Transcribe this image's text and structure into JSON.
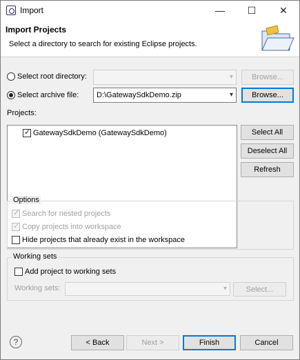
{
  "window": {
    "title": "Import",
    "minimize_glyph": "—",
    "maximize_glyph": "☐",
    "close_glyph": "✕"
  },
  "header": {
    "title": "Import Projects",
    "description": "Select a directory to search for existing Eclipse projects."
  },
  "source": {
    "root_directory_label": "Select root directory:",
    "root_directory_value": "",
    "archive_file_label": "Select archive file:",
    "archive_file_value": "D:\\GatewaySdkDemo.zip",
    "browse_label": "Browse...",
    "selected": "archive"
  },
  "projects": {
    "label": "Projects:",
    "items": [
      {
        "label": "GatewaySdkDemo (GatewaySdkDemo)",
        "checked": true
      }
    ],
    "select_all": "Select All",
    "deselect_all": "Deselect All",
    "refresh": "Refresh"
  },
  "options": {
    "title": "Options",
    "search_nested": "Search for nested projects",
    "copy_into_workspace": "Copy projects into workspace",
    "hide_existing": "Hide projects that already exist in the workspace"
  },
  "working_sets": {
    "title": "Working sets",
    "add_to_working_sets": "Add project to working sets",
    "working_sets_label": "Working sets:",
    "select_button": "Select..."
  },
  "footer": {
    "help_glyph": "?",
    "back": "< Back",
    "next": "Next >",
    "finish": "Finish",
    "cancel": "Cancel"
  }
}
